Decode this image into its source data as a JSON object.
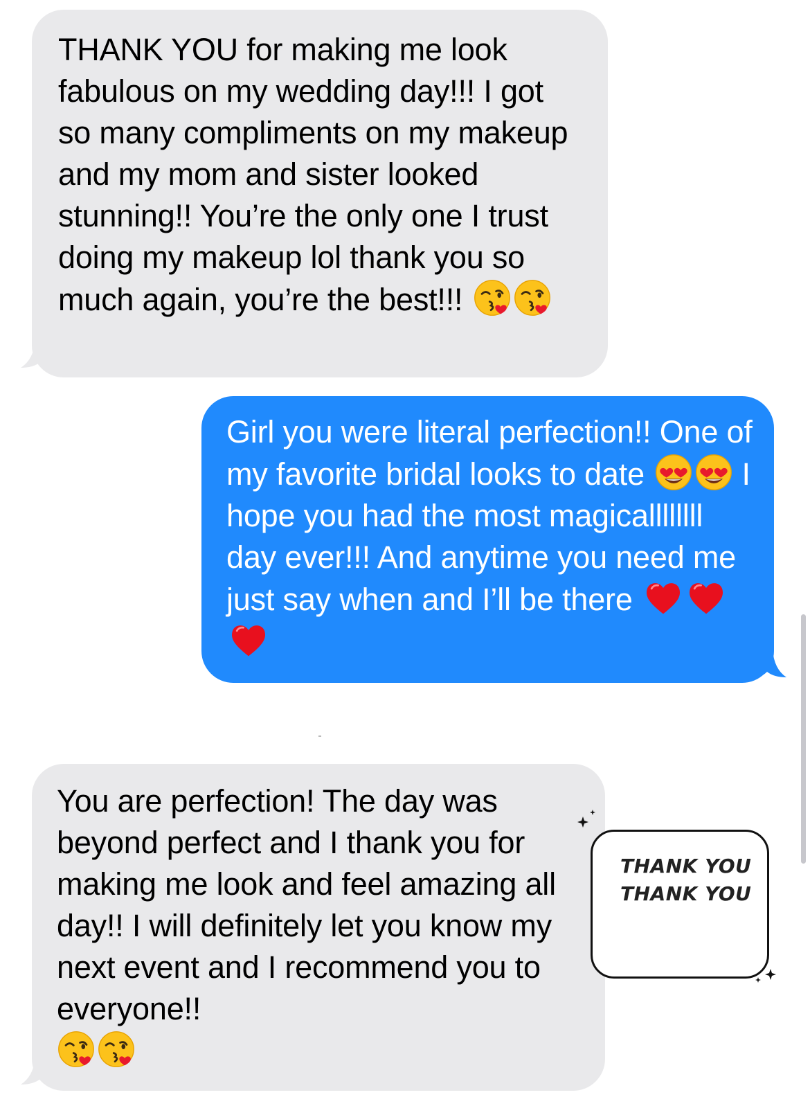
{
  "colors": {
    "incoming_bubble": "#e9e9eb",
    "outgoing_bubble": "#208afd",
    "incoming_text": "#000000",
    "outgoing_text": "#ffffff"
  },
  "messages": [
    {
      "direction": "incoming",
      "text": "THANK YOU for making me look fabulous on my wedding day!!! I got so many compliments on my makeup and my mom and sister looked stunning!! You’re the only one I trust doing my makeup lol thank you so much again, you’re the best!!!",
      "trailing_emojis": [
        "kissing-heart-emoji",
        "kissing-heart-emoji"
      ]
    },
    {
      "direction": "outgoing",
      "text_part1": "Girl you were literal perfection!! One of my favorite bridal looks to date",
      "mid_emojis": [
        "heart-eyes-emoji",
        "heart-eyes-emoji"
      ],
      "text_part2": "I hope you had the most magicallllllll day ever!!! And anytime you need me just say when and I’ll be there",
      "trailing_emojis": [
        "red-heart-emoji",
        "red-heart-emoji",
        "red-heart-emoji"
      ]
    },
    {
      "direction": "incoming",
      "text": "You are perfection! The day was beyond perfect and I thank you for making me look and feel amazing all day!! I will definitely let you know my next event and I recommend you to everyone!!",
      "trailing_emojis": [
        "kissing-heart-emoji",
        "kissing-heart-emoji"
      ]
    }
  ],
  "sticker": {
    "line1": "THANK YOU",
    "line2": "THANK YOU"
  }
}
